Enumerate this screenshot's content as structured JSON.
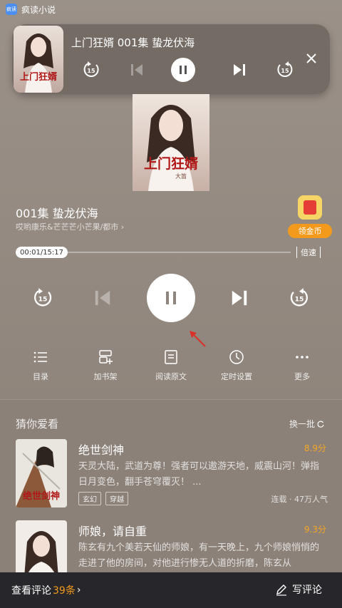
{
  "status": {
    "app_icon_text": "疯读",
    "app_name": "疯读小说"
  },
  "mini_player": {
    "title": "上门狂婿 001集 蛰龙伏海",
    "cover_text": "上门狂婿"
  },
  "cover": {
    "title_text": "上门狂婿",
    "author_text": "大笛"
  },
  "episode": {
    "title": "001集 蛰龙伏海",
    "author": "哎哟康乐&芒芒芒小芒果/都市",
    "coin_label": "领金币"
  },
  "progress": {
    "time": "00:01/15:17",
    "played_fraction": 0.0011,
    "speed_label": "倍速"
  },
  "controls": {
    "rewind_seconds": "15",
    "forward_seconds": "15"
  },
  "tools": [
    {
      "label": "目录",
      "icon": "list-icon"
    },
    {
      "label": "加书架",
      "icon": "bookshelf-icon"
    },
    {
      "label": "阅读原文",
      "icon": "read-icon"
    },
    {
      "label": "定时设置",
      "icon": "timer-icon"
    },
    {
      "label": "更多",
      "icon": "more-icon"
    }
  ],
  "recommend": {
    "heading": "猜你爱看",
    "refresh_label": "换一批",
    "books": [
      {
        "title": "绝世剑神",
        "score": "8.9分",
        "desc": "天灵大陆，武道为尊！强者可以遨游天地，威震山河！弹指日月变色，翻手苍穹覆灭！ ...",
        "tags": [
          "玄幻",
          "穿越"
        ],
        "stat": "连载 · 47万人气",
        "cover_text": "绝世剑神"
      },
      {
        "title": "师娘，请自重",
        "score": "9.3分",
        "desc": "陈玄有九个美若天仙的师娘，有一天晚上，九个师娘悄悄的走进了他的房间，对他进行惨无人道的折磨，陈玄从",
        "cover_text": ""
      }
    ]
  },
  "bottom_bar": {
    "comments_label": "查看评论",
    "comments_count": "39条",
    "write_label": "写评论"
  },
  "colors": {
    "accent": "#f39a1d",
    "score": "#f5a623",
    "bar": "#27272b"
  }
}
